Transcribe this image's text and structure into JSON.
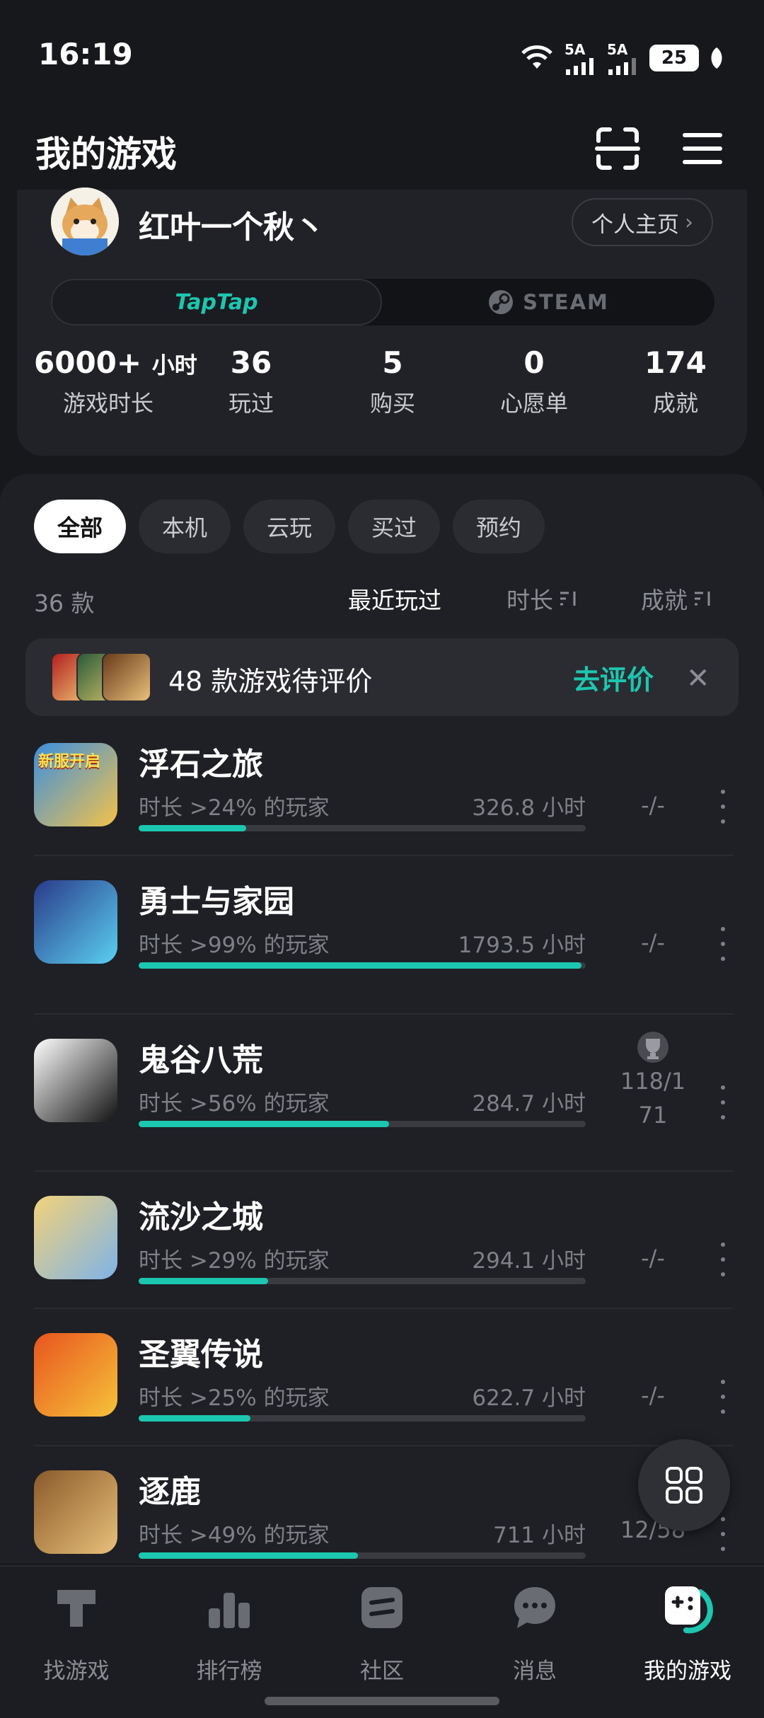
{
  "status_bar": {
    "time": "16:19",
    "network1": "5A",
    "network2": "5A",
    "battery": "25"
  },
  "header": {
    "title": "我的游戏",
    "scan_icon": "scan-icon",
    "menu_icon": "menu-icon"
  },
  "profile": {
    "username": "红叶一个秋丶",
    "homepage_label": "个人主页",
    "platforms": [
      "TapTap",
      "STEAM"
    ],
    "stats": [
      {
        "value": "6000+",
        "unit": "小时",
        "label": "游戏时长"
      },
      {
        "value": "36",
        "unit": "",
        "label": "玩过"
      },
      {
        "value": "5",
        "unit": "",
        "label": "购买"
      },
      {
        "value": "0",
        "unit": "",
        "label": "心愿单"
      },
      {
        "value": "174",
        "unit": "",
        "label": "成就"
      }
    ]
  },
  "filters": [
    "全部",
    "本机",
    "云玩",
    "买过",
    "预约"
  ],
  "list_header": {
    "count": "36 款",
    "sort_options": [
      "最近玩过",
      "时长",
      "成就"
    ]
  },
  "review_banner": {
    "text": "48 款游戏待评价",
    "action": "去评价"
  },
  "games": [
    {
      "name": "浮石之旅",
      "rank": "时长 >24% 的玩家",
      "hours": "326.8 小时",
      "progress": 0.24,
      "achievement": "-/-",
      "badge": "新服开启",
      "colors": [
        "#3a8fe0",
        "#f3c24a"
      ]
    },
    {
      "name": "勇士与家园",
      "rank": "时长 >99% 的玩家",
      "hours": "1793.5 小时",
      "progress": 0.99,
      "achievement": "-/-",
      "badge": "",
      "colors": [
        "#2a3a8a",
        "#5ad0f0"
      ]
    },
    {
      "name": "鬼谷八荒",
      "rank": "时长 >56% 的玩家",
      "hours": "284.7 小时",
      "progress": 0.56,
      "achievement": "118/171",
      "badge": "",
      "colors": [
        "#ffffff",
        "#111111"
      ]
    },
    {
      "name": "流沙之城",
      "rank": "时长 >29% 的玩家",
      "hours": "294.1 小时",
      "progress": 0.29,
      "achievement": "-/-",
      "badge": "",
      "colors": [
        "#f2d27a",
        "#7fb3e8"
      ]
    },
    {
      "name": "圣翼传说",
      "rank": "时长 >25% 的玩家",
      "hours": "622.7 小时",
      "progress": 0.25,
      "achievement": "-/-",
      "badge": "",
      "colors": [
        "#e8541e",
        "#f6c33a"
      ]
    },
    {
      "name": "逐鹿",
      "rank": "时长 >49% 的玩家",
      "hours": "711 小时",
      "progress": 0.49,
      "achievement": "12/58",
      "badge": "",
      "colors": [
        "#8a5a2a",
        "#e8c07a"
      ]
    }
  ],
  "bottom_nav": [
    {
      "label": "找游戏",
      "icon": "taptap-logo-icon"
    },
    {
      "label": "排行榜",
      "icon": "ranking-icon"
    },
    {
      "label": "社区",
      "icon": "community-icon"
    },
    {
      "label": "消息",
      "icon": "message-icon"
    },
    {
      "label": "我的游戏",
      "icon": "my-games-icon"
    }
  ],
  "theme": {
    "accent": "#1cc7b0",
    "background": "#17181c",
    "card": "#212227"
  }
}
